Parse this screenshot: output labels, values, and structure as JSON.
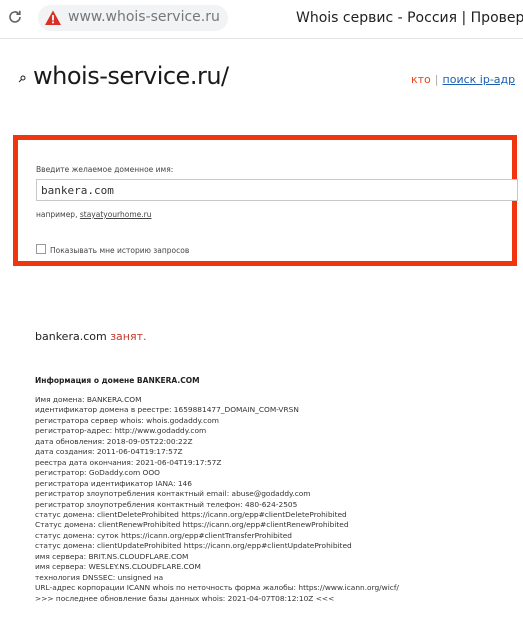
{
  "browser": {
    "url": "www.whois-service.ru",
    "tab_title": "Whois сервис - Россия | Провер"
  },
  "header": {
    "logo_text": "whois-service.ru/",
    "links": {
      "who": "кто",
      "ip_search": "поиск ip-адр"
    }
  },
  "search": {
    "label": "Введите желаемое доменное имя:",
    "input_value": "bankera.com",
    "example_prefix": "например,",
    "example_link": "stayatyourhome.ru",
    "history_label": "Показывать мне историю запросов",
    "history_checked": false
  },
  "result": {
    "domain": "bankera.com",
    "status": "занят."
  },
  "whois": {
    "title": "Информация о домене BANKERA.COM",
    "lines": [
      "Имя домена: BANKERA.COM",
      "идентификатор домена в реестре: 1659881477_DOMAIN_COM-VRSN",
      "регистратора сервер whois: whois.godaddy.com",
      "регистратор-адрес: http://www.godaddy.com",
      "дата обновления: 2018-09-05T22:00:22Z",
      "дата создания: 2011-06-04T19:17:57Z",
      "реестра дата окончания: 2021-06-04T19:17:57Z",
      "регистратор: GoDaddy.com ООО",
      "регистратора идентификатор IANA: 146",
      "регистратор злоупотребления контактный email: abuse@godaddy.com",
      "регистратор злоупотребления контактный телефон: 480-624-2505",
      "статус домена: clientDeleteProhibited https://icann.org/epp#clientDeleteProhibited",
      "Статус домена: clientRenewProhibited https://icann.org/epp#clientRenewProhibited",
      "статус домена: суток https://icann.org/epp#clientTransferProhibited",
      "статус домена: clientUpdateProhibited https://icann.org/epp#clientUpdateProhibited",
      "имя сервера: BRIT.NS.CLOUDFLARE.COM",
      "имя сервера: WESLEY.NS.CLOUDFLARE.COM",
      "технология DNSSEC: unsigned на",
      "URL-адрес корпорации ICANN whois по неточность форма жалобы: https://www.icann.org/wicf/",
      ">>> последнее обновление базы данных whois: 2021-04-07T08:12:10Z <<<"
    ]
  },
  "colors": {
    "accent_border": "#f0350f",
    "taken": "#c0392b",
    "link": "#1a5fb4"
  }
}
